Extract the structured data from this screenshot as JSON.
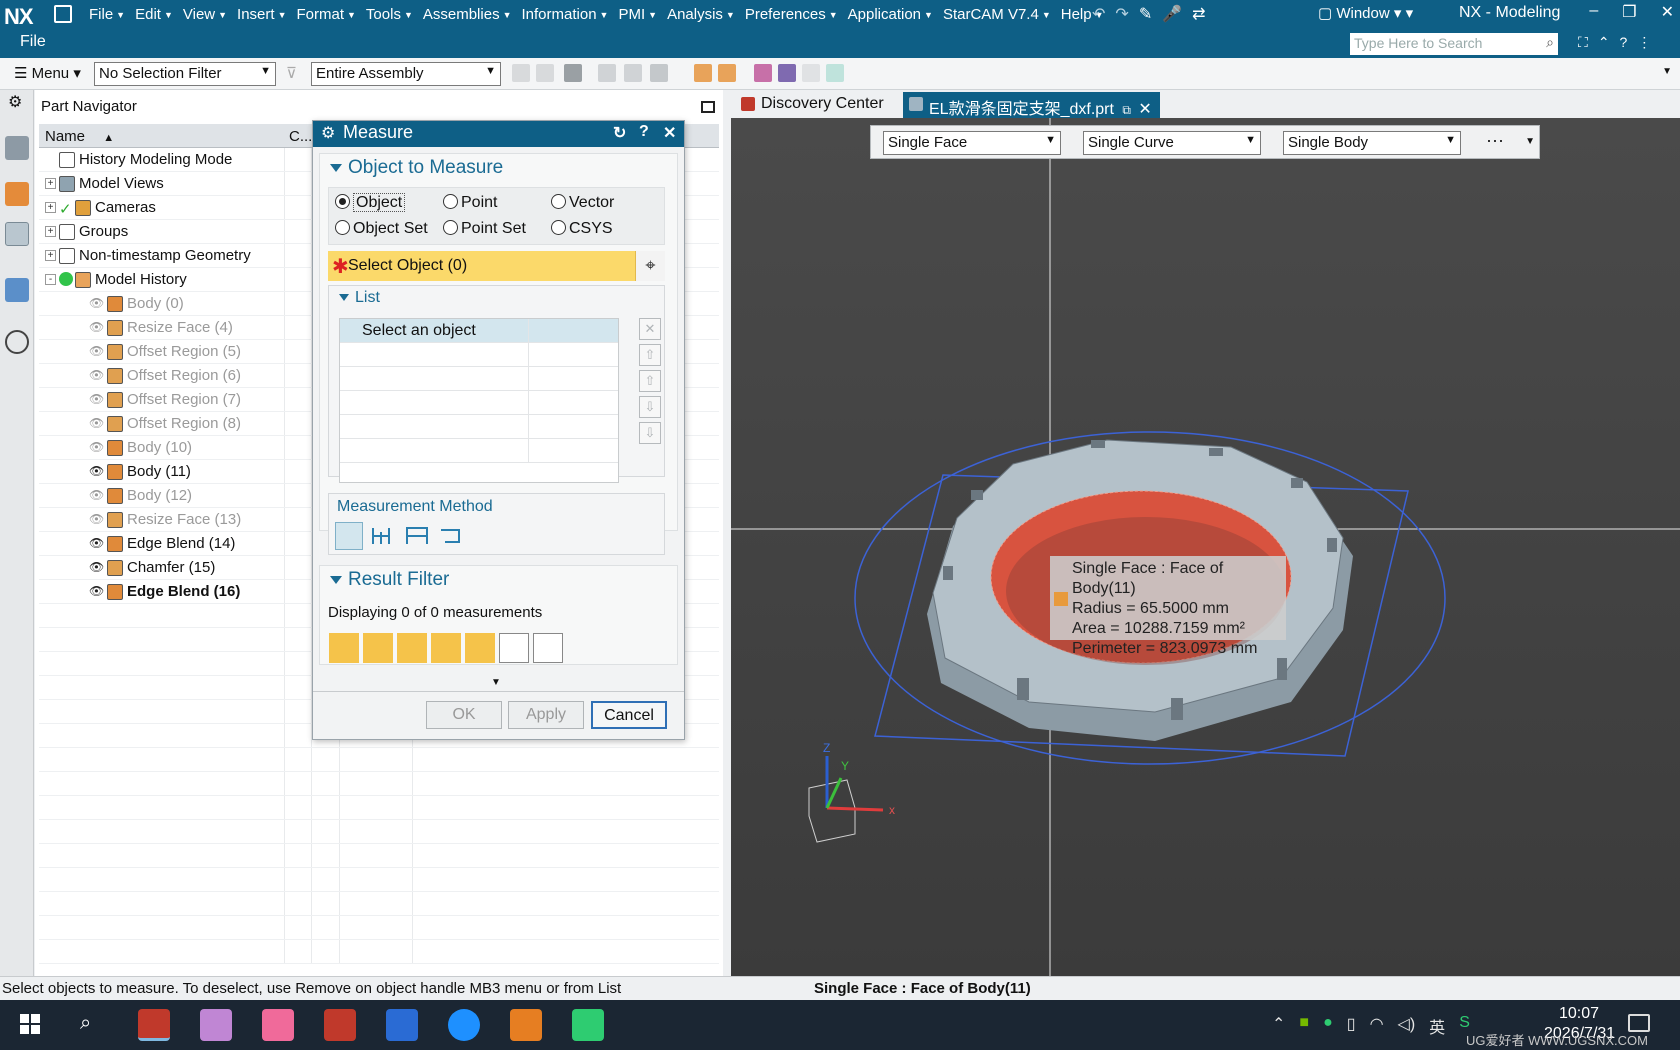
{
  "titlebar": {
    "logo": "NX",
    "menus": [
      "File",
      "Edit",
      "View",
      "Insert",
      "Format",
      "Tools",
      "Assemblies",
      "Information",
      "PMI",
      "Analysis",
      "Preferences",
      "Application",
      "StarCAM V7.4",
      "Help"
    ],
    "window_menu": "Window",
    "app_title": "NX - Modeling",
    "file_tab": "File",
    "search_placeholder": "Type Here to Search"
  },
  "toolbar": {
    "menu_label": "Menu",
    "selection_filter": "No Selection Filter",
    "assembly_scope": "Entire Assembly"
  },
  "part_navigator": {
    "title": "Part Navigator",
    "col_name": "Name",
    "col_c": "C...",
    "rows": [
      {
        "label": "History Modeling Mode",
        "indent": 0,
        "expander": "",
        "dim": false,
        "bold": false,
        "icon": "clock-icon"
      },
      {
        "label": "Model Views",
        "indent": 0,
        "expander": "+",
        "dim": false,
        "bold": false,
        "icon": "model-views-icon"
      },
      {
        "label": "Cameras",
        "indent": 0,
        "expander": "+",
        "dim": false,
        "bold": false,
        "icon": "camera-icon"
      },
      {
        "label": "Groups",
        "indent": 0,
        "expander": "+",
        "dim": false,
        "bold": false,
        "icon": "group-icon"
      },
      {
        "label": "Non-timestamp Geometry",
        "indent": 0,
        "expander": "+",
        "dim": false,
        "bold": false,
        "icon": "folder-icon"
      },
      {
        "label": "Model History",
        "indent": 0,
        "expander": "-",
        "dim": false,
        "bold": false,
        "icon": "model-history-icon"
      },
      {
        "label": "Body (0)",
        "indent": 1,
        "expander": "",
        "dim": true,
        "bold": false,
        "icon": "body-icon"
      },
      {
        "label": "Resize Face (4)",
        "indent": 1,
        "expander": "",
        "dim": true,
        "bold": false,
        "icon": "resize-face-icon"
      },
      {
        "label": "Offset Region (5)",
        "indent": 1,
        "expander": "",
        "dim": true,
        "bold": false,
        "icon": "offset-region-icon"
      },
      {
        "label": "Offset Region (6)",
        "indent": 1,
        "expander": "",
        "dim": true,
        "bold": false,
        "icon": "offset-region-icon"
      },
      {
        "label": "Offset Region (7)",
        "indent": 1,
        "expander": "",
        "dim": true,
        "bold": false,
        "icon": "offset-region-icon"
      },
      {
        "label": "Offset Region (8)",
        "indent": 1,
        "expander": "",
        "dim": true,
        "bold": false,
        "icon": "offset-region-icon"
      },
      {
        "label": "Body (10)",
        "indent": 1,
        "expander": "",
        "dim": true,
        "bold": false,
        "icon": "body-icon"
      },
      {
        "label": "Body (11)",
        "indent": 1,
        "expander": "",
        "dim": false,
        "bold": false,
        "icon": "body-icon"
      },
      {
        "label": "Body (12)",
        "indent": 1,
        "expander": "",
        "dim": true,
        "bold": false,
        "icon": "body-icon"
      },
      {
        "label": "Resize Face (13)",
        "indent": 1,
        "expander": "",
        "dim": true,
        "bold": false,
        "icon": "resize-face-icon"
      },
      {
        "label": "Edge Blend (14)",
        "indent": 1,
        "expander": "",
        "dim": false,
        "bold": false,
        "icon": "edge-blend-icon"
      },
      {
        "label": "Chamfer (15)",
        "indent": 1,
        "expander": "",
        "dim": false,
        "bold": false,
        "icon": "chamfer-icon"
      },
      {
        "label": "Edge Blend (16)",
        "indent": 1,
        "expander": "",
        "dim": false,
        "bold": true,
        "icon": "edge-blend-icon"
      }
    ]
  },
  "measure": {
    "title": "Measure",
    "section_object": "Object to Measure",
    "radios": [
      {
        "label": "Object",
        "checked": true
      },
      {
        "label": "Point",
        "checked": false
      },
      {
        "label": "Vector",
        "checked": false
      },
      {
        "label": "Object Set",
        "checked": false
      },
      {
        "label": "Point Set",
        "checked": false
      },
      {
        "label": "CSYS",
        "checked": false
      }
    ],
    "select_object": "Select Object (0)",
    "list_title": "List",
    "list_first_row": "Select an object",
    "measurement_method": "Measurement Method",
    "section_result": "Result Filter",
    "displaying": "Displaying 0 of 0 measurements",
    "ok": "OK",
    "apply": "Apply",
    "cancel": "Cancel"
  },
  "graphics": {
    "tab_discovery": "Discovery Center",
    "tab_part": "EL款滑条固定支架_dxf.prt",
    "filter_face": "Single Face",
    "filter_curve": "Single Curve",
    "filter_body": "Single Body",
    "tooltip": {
      "line1": "Single Face : Face of Body(11)",
      "line2": "Radius = 65.5000 mm",
      "line3": "Area = 10288.7159 mm²",
      "line4": "Perimeter = 823.0973 mm"
    },
    "triad_x": "x",
    "triad_y": "Y",
    "triad_z": "Z"
  },
  "statusbar": {
    "prompt": "Select objects to measure. To deselect, use Remove on object handle MB3 menu or from List",
    "info": "Single Face : Face of Body(11)"
  },
  "taskbar": {
    "ime": "英",
    "time": "10:07",
    "date": "2026/7/31",
    "watermark": "UG爱好者 WWW.UGSNX.COM"
  },
  "colors": {
    "titlebar": "#0e5f86",
    "select_highlight": "#fbd96a",
    "face_highlight": "#d84c3e",
    "part_body": "#aebcc4",
    "taskbar": "#1b2633"
  }
}
